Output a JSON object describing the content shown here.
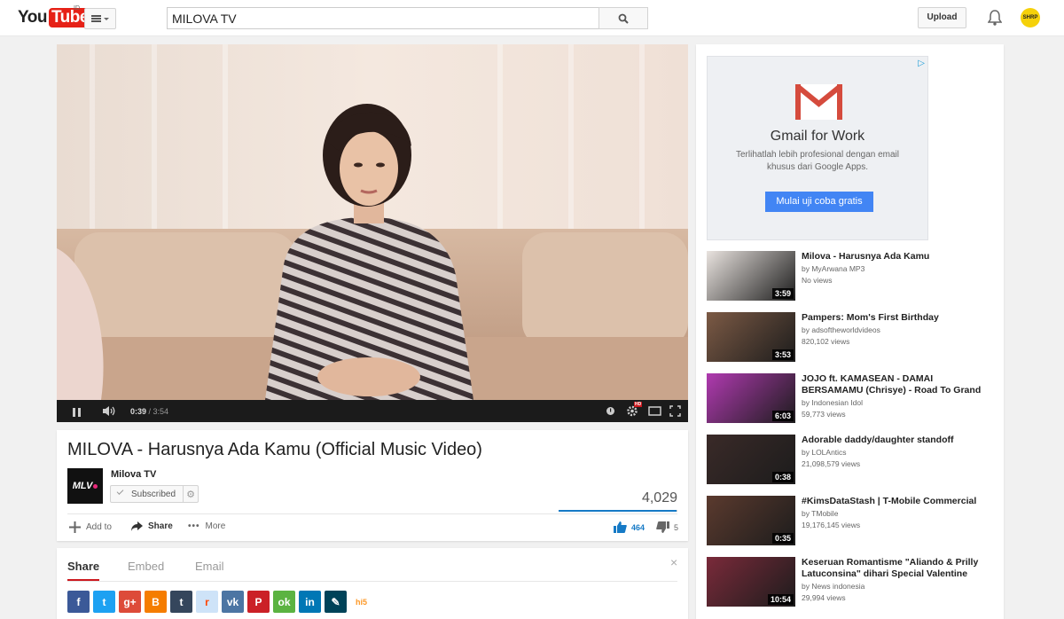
{
  "header": {
    "logo_you": "You",
    "logo_tube": "Tube",
    "logo_country": "ID",
    "search_value": "MILOVA TV",
    "upload_label": "Upload",
    "avatar_text": "SHRP"
  },
  "player": {
    "current_time": "0:39",
    "duration": "3:54",
    "progress": 0.167,
    "hd_badge": "HD"
  },
  "video": {
    "title": "MILOVA - Harusnya Ada Kamu (Official Music Video)",
    "channel_logo": "MLV",
    "channel_name": "Milova TV",
    "subscribe_label": "Subscribed",
    "views": "4,029",
    "like_ratio": 0.99,
    "likes": "464",
    "dislikes": "5",
    "actions": {
      "add_to": "Add to",
      "share": "Share",
      "more": "More"
    }
  },
  "share_panel": {
    "tabs": [
      "Share",
      "Embed",
      "Email"
    ],
    "close": "×",
    "socials": [
      {
        "name": "facebook",
        "glyph": "f",
        "color": "#3b5998"
      },
      {
        "name": "twitter",
        "glyph": "t",
        "color": "#1da1f2"
      },
      {
        "name": "google-plus",
        "glyph": "g+",
        "color": "#dd4b39"
      },
      {
        "name": "blogger",
        "glyph": "B",
        "color": "#f57d00"
      },
      {
        "name": "tumblr",
        "glyph": "t",
        "color": "#35465c"
      },
      {
        "name": "reddit",
        "glyph": "r",
        "color": "#cee3f8"
      },
      {
        "name": "vk",
        "glyph": "vk",
        "color": "#4c75a3"
      },
      {
        "name": "pinterest",
        "glyph": "P",
        "color": "#cb2027"
      },
      {
        "name": "odnoklassniki",
        "glyph": "ok",
        "color": "#5bb341"
      },
      {
        "name": "linkedin",
        "glyph": "in",
        "color": "#0077b5"
      },
      {
        "name": "livejournal",
        "glyph": "✎",
        "color": "#004359"
      },
      {
        "name": "hi5",
        "glyph": "hi5",
        "color": "#fd9827"
      }
    ]
  },
  "ad": {
    "title": "Gmail for Work",
    "subtitle": "Terlihatlah lebih profesional dengan email khusus dari Google Apps.",
    "cta": "Mulai uji coba gratis",
    "choices_icon": "ad-choices-icon"
  },
  "related": [
    {
      "title": "Milova - Harusnya Ada Kamu",
      "channel": "by MyArwana MP3",
      "views": "No views",
      "duration": "3:59",
      "thumb_color": "#e9e3df"
    },
    {
      "title": "Pampers: Mom's First Birthday",
      "channel": "by adsoftheworldvideos",
      "views": "820,102 views",
      "duration": "3:53",
      "thumb_color": "#7c5a45"
    },
    {
      "title": "JOJO ft. KAMASEAN - DAMAI BERSAMAMU (Chrisye) - Road To Grand",
      "channel": "by Indonesian Idol",
      "views": "59,773 views",
      "duration": "6:03",
      "thumb_color": "#b03ab0"
    },
    {
      "title": "Adorable daddy/daughter standoff",
      "channel": "by LOLAntics",
      "views": "21,098,579 views",
      "duration": "0:38",
      "thumb_color": "#3a2a28"
    },
    {
      "title": "#KimsDataStash | T-Mobile Commercial",
      "channel": "by TMobile",
      "views": "19,176,145 views",
      "duration": "0:35",
      "thumb_color": "#5b3a2e"
    },
    {
      "title": "Keseruan Romantisme \"Aliando & Prilly Latuconsina\" dihari Special Valentine",
      "channel": "by News indonesia",
      "views": "29,994 views",
      "duration": "10:54",
      "thumb_color": "#7a2a3a"
    }
  ]
}
